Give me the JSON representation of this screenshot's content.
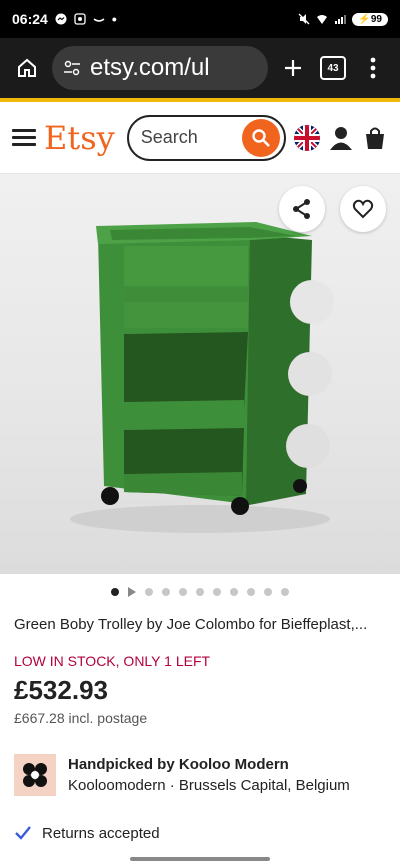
{
  "status": {
    "time": "06:24",
    "battery": "99"
  },
  "browser": {
    "url": "etsy.com/ul",
    "tab_count": "43"
  },
  "etsy": {
    "logo": "Etsy",
    "search_placeholder": "Search"
  },
  "listing": {
    "title": "Green Boby Trolley by Joe Colombo for Bieffeplast,...",
    "stock": "LOW IN STOCK, ONLY 1 LEFT",
    "price": "£532.93",
    "postage": "£667.28 incl. postage"
  },
  "shop": {
    "handpicked": "Handpicked by Kooloo Modern",
    "location": "Kooloomodern · Brussels Capital, Belgium"
  },
  "returns": "Returns accepted",
  "carousel": {
    "active_index": 0,
    "count": 11
  },
  "colors": {
    "etsy_orange": "#f1641e",
    "stock_red": "#b3003b",
    "product_green": "#3e8f3a"
  }
}
